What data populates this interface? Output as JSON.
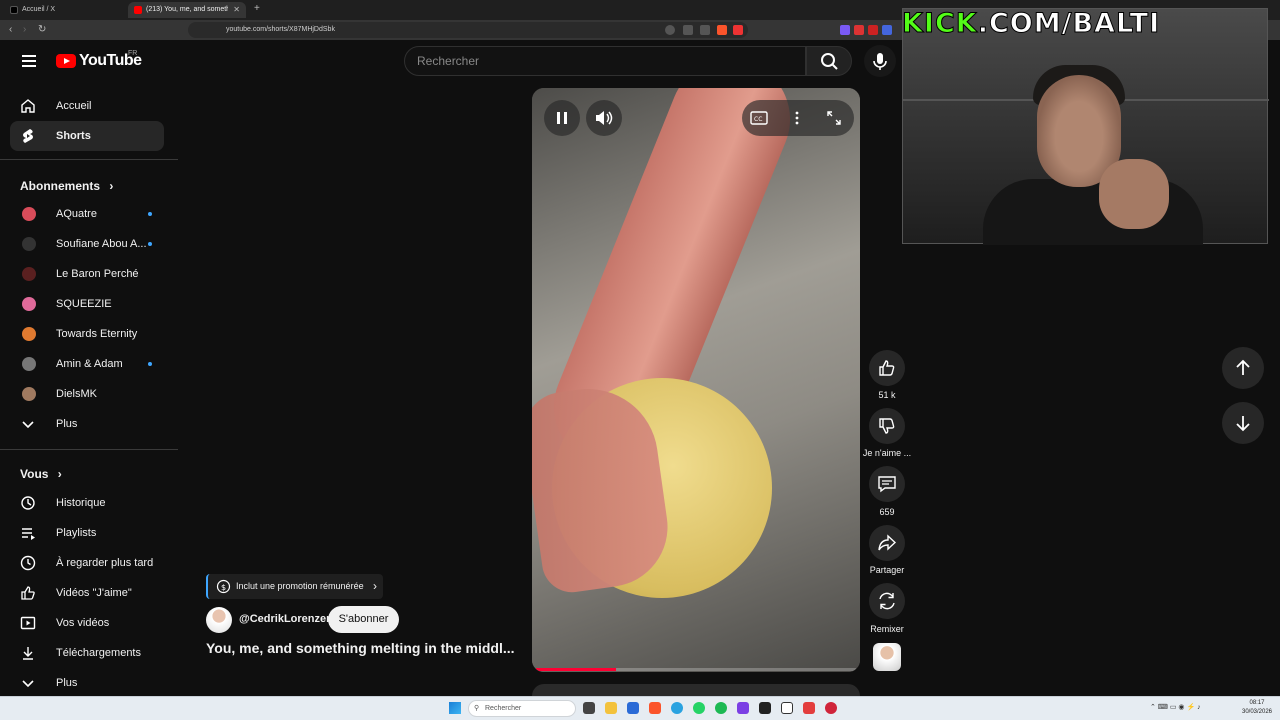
{
  "browser": {
    "tabs": [
      {
        "label": "Accueil / X",
        "favicon": "x-logo-icon"
      },
      {
        "label": "(213) You, me, and something",
        "favicon": "youtube-logo-icon",
        "audio": "speaker-icon"
      }
    ],
    "url": "youtube.com/shorts/X87MHjDdSbk"
  },
  "header": {
    "logo_text": "YouTube",
    "country": "FR",
    "search_placeholder": "Rechercher"
  },
  "sidebar": {
    "main": [
      {
        "label": "Accueil",
        "icon": "home-icon"
      },
      {
        "label": "Shorts",
        "icon": "shorts-icon",
        "active": true
      }
    ],
    "subscriptions_title": "Abonnements",
    "subscriptions": [
      {
        "label": "AQuatre",
        "dot": true,
        "color": "#d94c5a"
      },
      {
        "label": "Soufiane Abou A...",
        "dot": true,
        "color": "#333333"
      },
      {
        "label": "Le Baron Perché",
        "dot": false,
        "color": "#5a2020"
      },
      {
        "label": "SQUEEZIE",
        "dot": false,
        "color": "#e06a9a"
      },
      {
        "label": "Towards Eternity",
        "dot": false,
        "color": "#e07a30"
      },
      {
        "label": "Amin & Adam",
        "dot": true,
        "color": "#777777"
      },
      {
        "label": "DielsMK",
        "dot": false,
        "color": "#a07a60"
      }
    ],
    "subscriptions_more": "Plus",
    "you_title": "Vous",
    "you": [
      {
        "label": "Historique",
        "icon": "history-icon"
      },
      {
        "label": "Playlists",
        "icon": "playlist-icon"
      },
      {
        "label": "À regarder plus tard",
        "icon": "clock-icon"
      },
      {
        "label": "Vidéos \"J'aime\"",
        "icon": "thumbs-up-icon"
      },
      {
        "label": "Vos vidéos",
        "icon": "video-icon"
      },
      {
        "label": "Téléchargements",
        "icon": "download-icon"
      }
    ],
    "you_more": "Plus"
  },
  "video": {
    "promo": "Inclut une promotion rémunérée",
    "channel": "@CedrikLorenzen",
    "subscribe": "S'abonner",
    "title": "You, me, and something melting in the middl...",
    "progress": 0.25
  },
  "actions": {
    "like_count": "51 k",
    "dislike": "Je n'aime ...",
    "comments": "659",
    "share": "Partager",
    "remix": "Remixer"
  },
  "overlay": {
    "kick_a": "KICK",
    "kick_b": ".COM/BALTI"
  },
  "taskbar": {
    "search": "Rechercher",
    "time": "08:17",
    "date": "30/03/2026"
  },
  "colors": {
    "accent_red": "#ff0000",
    "kick_green": "#53fc18",
    "unread_dot": "#3ea6ff"
  }
}
